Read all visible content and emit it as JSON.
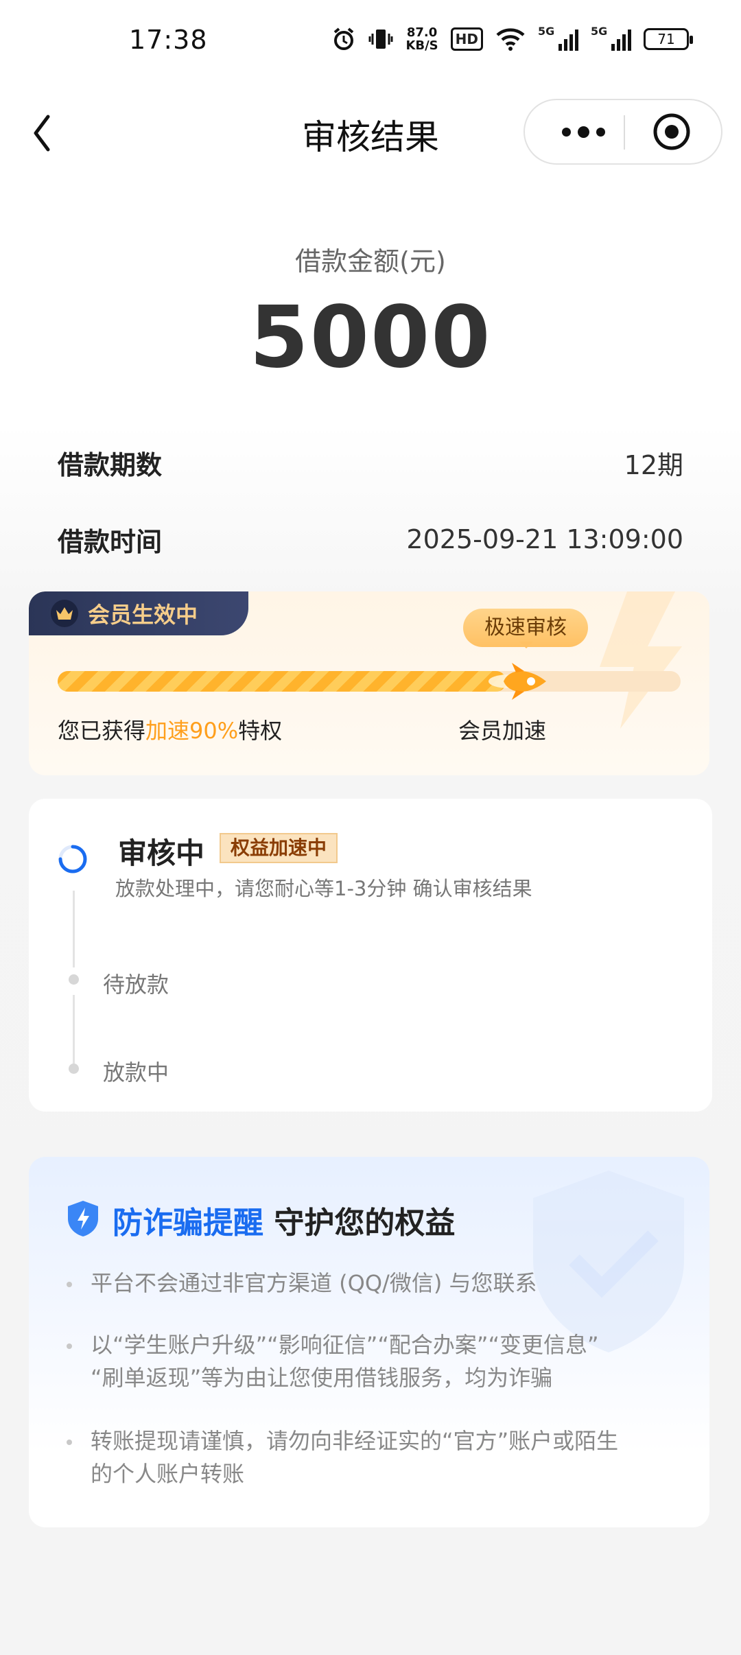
{
  "status_bar": {
    "time": "17:38",
    "net_speed_value": "87.0",
    "net_speed_unit": "KB/S",
    "hd_label": "HD",
    "sim1_label": "5G",
    "sim2_label": "5G",
    "battery": "71"
  },
  "nav": {
    "title": "审核结果"
  },
  "loan": {
    "amount_label": "借款金额(元)",
    "amount_value": "5000",
    "term_label": "借款期数",
    "term_value": "12期",
    "time_label": "借款时间",
    "time_value": "2025-09-21 13:09:00"
  },
  "member": {
    "badge": "会员生效中",
    "speed_tag": "极速审核",
    "progress_fraction": 0.72,
    "obtained_prefix": "您已获得",
    "obtained_highlight": "加速90%",
    "obtained_suffix": "特权",
    "right_label": "会员加速"
  },
  "review": {
    "title": "审核中",
    "badge": "权益加速中",
    "desc": "放款处理中，请您耐心等1-3分钟 确认审核结果",
    "step2": "待放款",
    "step3": "放款中"
  },
  "fraud": {
    "title_blue": "防诈骗提醒",
    "title_dark": "守护您的权益",
    "items": [
      "平台不会通过非官方渠道 (QQ/微信) 与您联系",
      "以“学生账户升级”“影响征信”“配合办案”“变更信息”",
      "“刷单返现”等为由让您使用借钱服务，均为诈骗",
      "转账提现请谨慎，请勿向非经证实的“官方”账户或陌生",
      "的个人账户转账"
    ]
  },
  "colors": {
    "accent_orange": "#ff9f1c",
    "accent_blue": "#1a6cf0",
    "badge_navy": "#2b3557"
  }
}
